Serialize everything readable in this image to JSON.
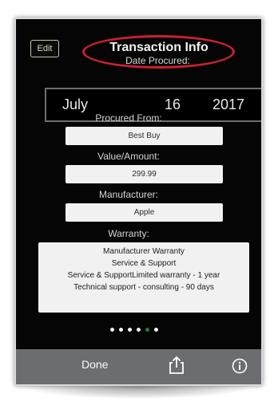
{
  "header": {
    "edit_label": "Edit",
    "title": "Transaction Info",
    "date_label": "Date Procured:"
  },
  "date": {
    "month": "July",
    "day": "16",
    "year": "2017"
  },
  "fields": {
    "procured_from_label": "Procured From:",
    "procured_from_value": "Best Buy",
    "value_label": "Value/Amount:",
    "value_value": "299.99",
    "manufacturer_label": "Manufacturer:",
    "manufacturer_value": "Apple",
    "warranty_label": "Warranty:",
    "warranty_lines": [
      "Manufacturer Warranty",
      "Service & Support",
      "Service & SupportLimited warranty - 1 year",
      "Technical support - consulting - 90 days"
    ]
  },
  "page_indicator": {
    "count": 6,
    "active_index": 4
  },
  "toolbar": {
    "done_label": "Done",
    "share_icon": "share-icon",
    "info_icon": "info-icon"
  },
  "colors": {
    "highlight_oval": "#cc1f2f",
    "active_dot": "#1f7a44",
    "toolbar_bg": "#6c6d70"
  }
}
